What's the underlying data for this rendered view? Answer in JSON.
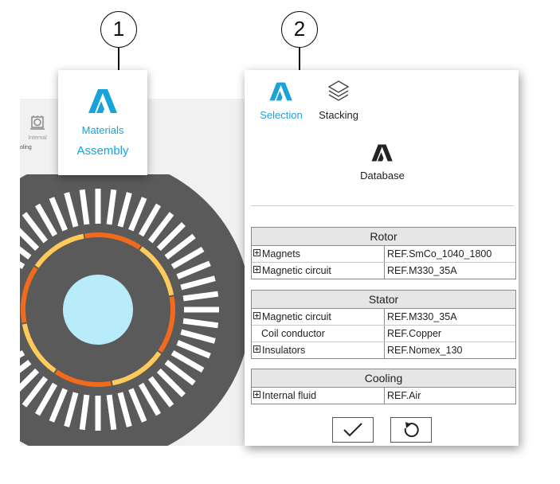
{
  "callouts": [
    "1",
    "2"
  ],
  "background": {
    "tool_label": "Internal",
    "clipped_text": "oling"
  },
  "panel1": {
    "icon": "materials-logo-icon",
    "materials_label": "Materials",
    "assembly_label": "Assembly"
  },
  "panel2": {
    "tabs": [
      {
        "label": "Selection",
        "icon": "materials-logo-icon",
        "active": true
      },
      {
        "label": "Stacking",
        "icon": "layers-icon",
        "active": false
      }
    ],
    "database_label": "Database",
    "sections": [
      {
        "title": "Rotor",
        "rows": [
          {
            "name": "Magnets",
            "value": "REF.SmCo_1040_1800",
            "expandable": true
          },
          {
            "name": "Magnetic circuit",
            "value": "REF.M330_35A",
            "expandable": true
          }
        ]
      },
      {
        "title": "Stator",
        "rows": [
          {
            "name": "Magnetic circuit",
            "value": "REF.M330_35A",
            "expandable": true
          },
          {
            "name": "Coil conductor",
            "value": "REF.Copper",
            "expandable": false
          },
          {
            "name": "Insulators",
            "value": "REF.Nomex_130",
            "expandable": true
          }
        ]
      },
      {
        "title": "Cooling",
        "rows": [
          {
            "name": "Internal fluid",
            "value": "REF.Air",
            "expandable": true
          }
        ]
      }
    ],
    "buttons": [
      {
        "icon": "checkmark-icon"
      },
      {
        "icon": "reset-icon"
      }
    ]
  },
  "colors": {
    "accent": "#1aa3d9",
    "stator": "#5a5a5a",
    "rotor_core": "#b8ecfa",
    "magnet_orange": "#f26a1b",
    "magnet_yellow": "#ffca5a"
  }
}
